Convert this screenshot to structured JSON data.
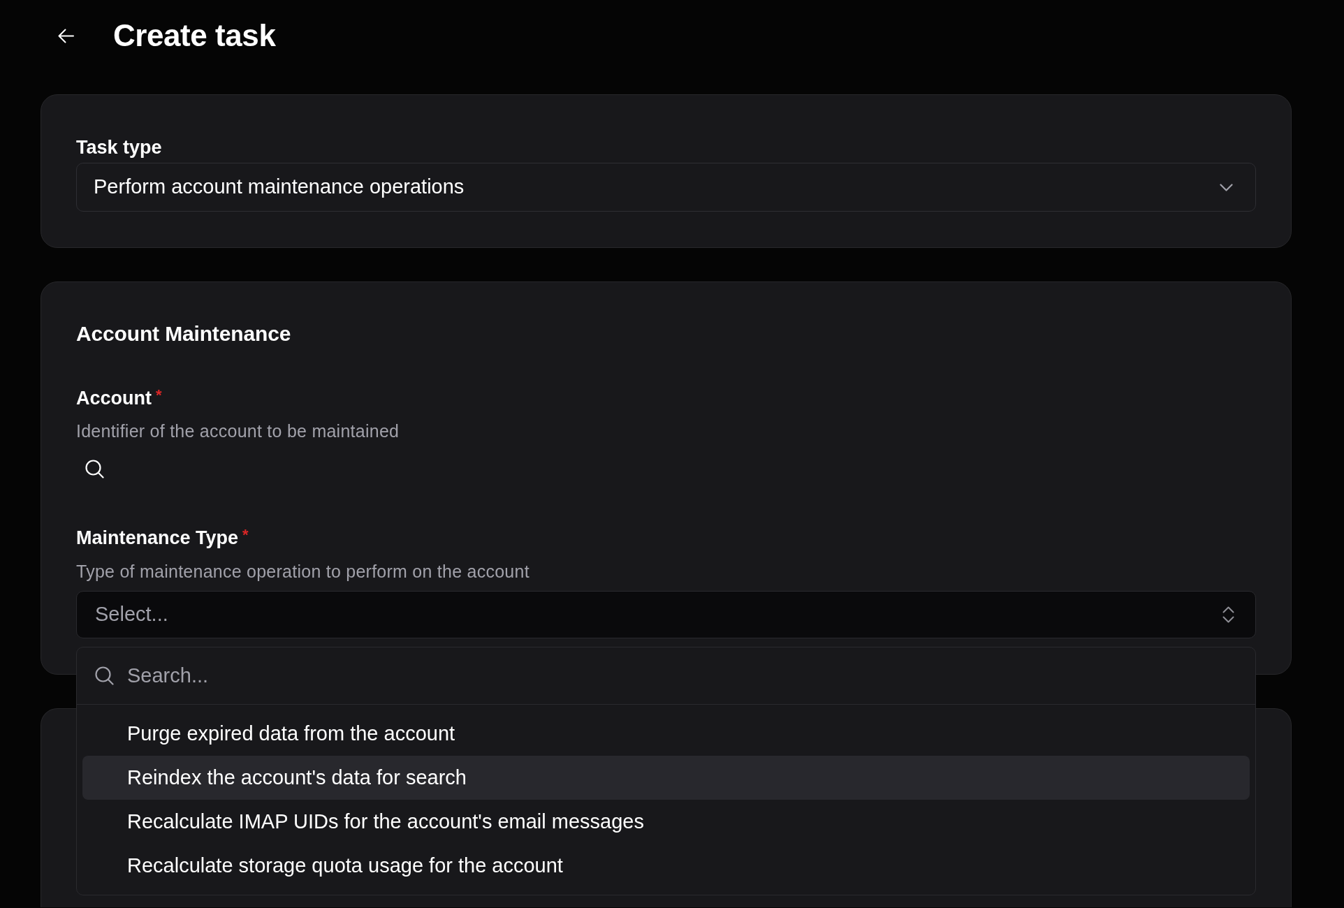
{
  "page": {
    "title": "Create task"
  },
  "task_type": {
    "label": "Task type",
    "value": "Perform account maintenance operations"
  },
  "maintenance": {
    "title": "Account Maintenance",
    "fields": [
      {
        "kind": "search",
        "label": "Account",
        "required_mark": "*",
        "description": "Identifier of the account to be maintained"
      },
      {
        "kind": "select",
        "label": "Maintenance Type",
        "required_mark": "*",
        "description": "Type of maintenance operation to perform on the account",
        "placeholder": "Select...",
        "expanded": true,
        "search_placeholder": "Search...",
        "options": [
          {
            "label": "Purge expired data from the account",
            "selected": false
          },
          {
            "label": "Reindex the account's data for search",
            "selected": true
          },
          {
            "label": "Recalculate IMAP UIDs for the account's email messages",
            "selected": false
          },
          {
            "label": "Recalculate storage quota usage for the account",
            "selected": false
          }
        ]
      }
    ]
  }
}
